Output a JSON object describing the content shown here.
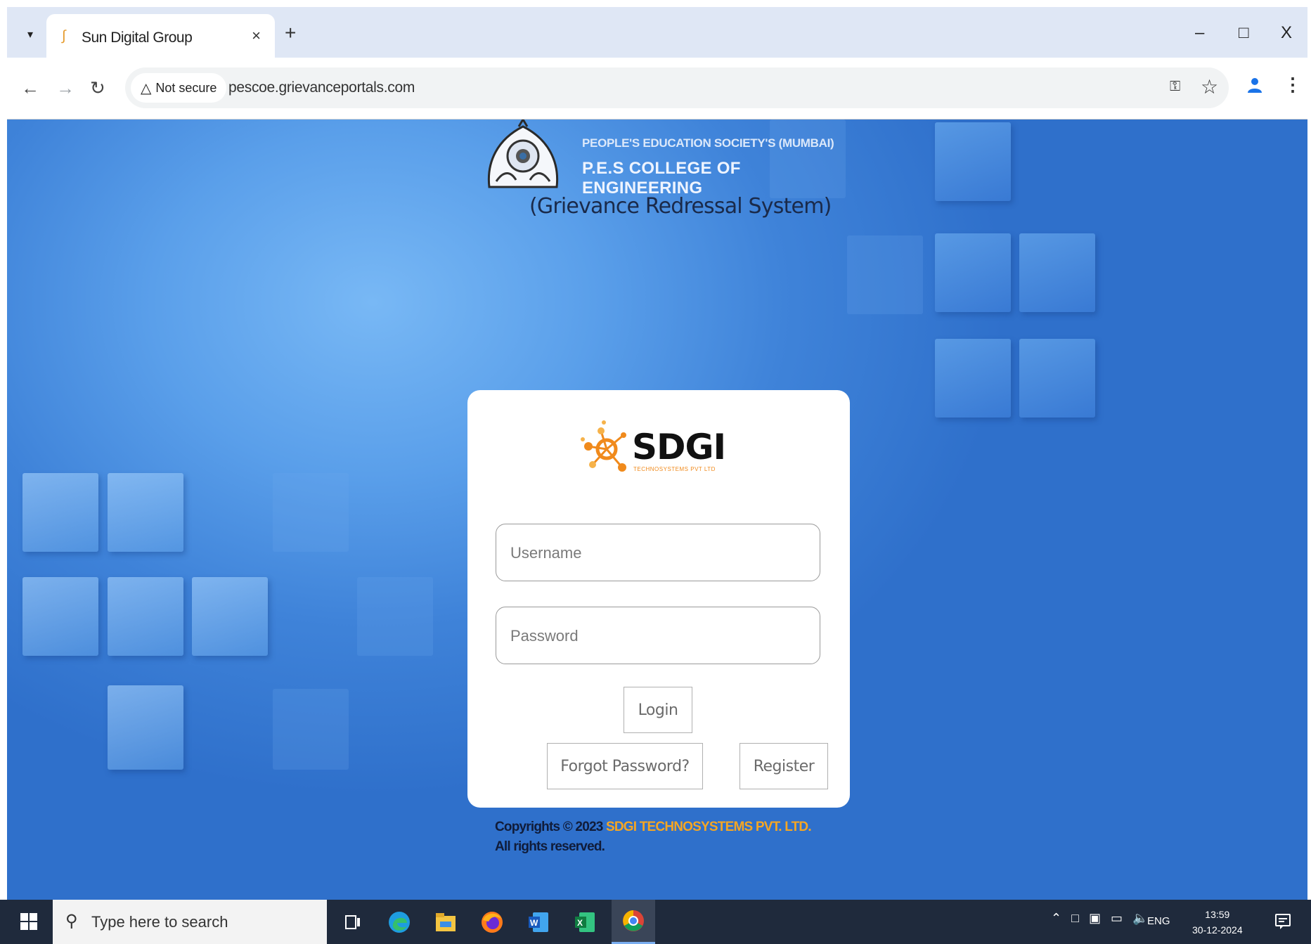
{
  "browser": {
    "tab_title": "Sun Digital Group",
    "tab_close": "×",
    "new_tab": "+",
    "security_label": "Not secure",
    "url": "pescoe.grievanceportals.com",
    "window_controls": {
      "minimize": "–",
      "maximize": "□",
      "close": "X"
    }
  },
  "header": {
    "society_name": "PEOPLE'S EDUCATION SOCIETY'S (MUMBAI)",
    "college_name": "P.E.S COLLEGE OF ENGINEERING",
    "system_title": "(Grievance Redressal System)"
  },
  "login": {
    "brand_name": "SDGI",
    "brand_tagline": "TECHNOSYSTEMS PVT LTD",
    "username_placeholder": "Username",
    "password_placeholder": "Password",
    "login_label": "Login",
    "forgot_label": "Forgot Password?",
    "register_label": "Register"
  },
  "footer": {
    "copyright_prefix": "Copyrights © 2023",
    "company": "SDGI TECHNOSYSTEMS PVT. LTD.",
    "rights": "All rights reserved."
  },
  "taskbar": {
    "search_placeholder": "Type here to search",
    "language": "ENG",
    "time": "13:59",
    "date": "30-12-2024"
  },
  "colors": {
    "page_blue": "#3f83d9",
    "company_orange": "#f5a623",
    "taskbar": "#1f2a3c"
  }
}
